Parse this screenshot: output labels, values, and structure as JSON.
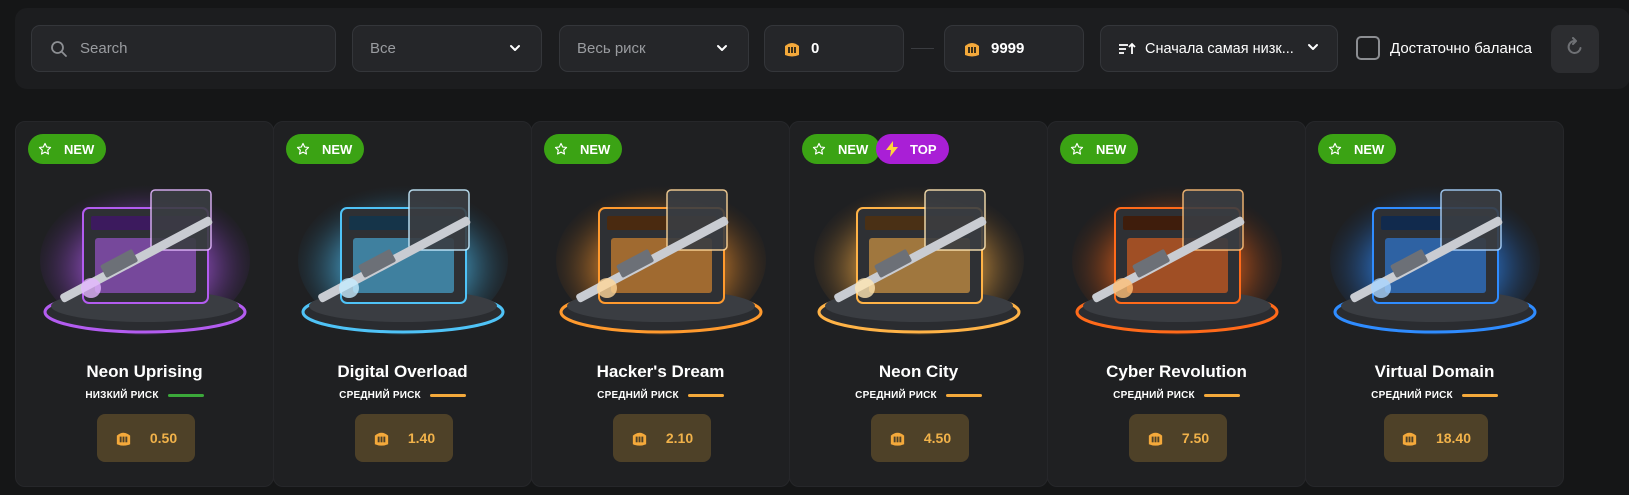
{
  "filters": {
    "search_placeholder": "Search",
    "category_value": "Все",
    "risk_value": "Весь риск",
    "price_min": "0",
    "price_max": "9999",
    "sort_value": "Сначала самая низк...",
    "balance_checkbox_label": "Достаточно баланса",
    "balance_checkbox_checked": false
  },
  "colors": {
    "accent_new": "#3ba314",
    "accent_top": "#a91fd6",
    "risk_low": "#3ba83a",
    "risk_medium": "#f4a93b",
    "price_text": "#f1b24a"
  },
  "cases": [
    {
      "name": "Neon Uprising",
      "badges": [
        "NEW"
      ],
      "risk": "НИЗКИЙ РИСК",
      "risk_level": "low",
      "price": "0.50",
      "theme": "purple"
    },
    {
      "name": "Digital Overload",
      "badges": [
        "NEW"
      ],
      "risk": "СРЕДНИЙ РИСК",
      "risk_level": "medium",
      "price": "1.40",
      "theme": "cyan"
    },
    {
      "name": "Hacker's Dream",
      "badges": [
        "NEW"
      ],
      "risk": "СРЕДНИЙ РИСК",
      "risk_level": "medium",
      "price": "2.10",
      "theme": "orange"
    },
    {
      "name": "Neon City",
      "badges": [
        "NEW",
        "TOP"
      ],
      "risk": "СРЕДНИЙ РИСК",
      "risk_level": "medium",
      "price": "4.50",
      "theme": "gold"
    },
    {
      "name": "Cyber Revolution",
      "badges": [
        "NEW"
      ],
      "risk": "СРЕДНИЙ РИСК",
      "risk_level": "medium",
      "price": "7.50",
      "theme": "fire"
    },
    {
      "name": "Virtual Domain",
      "badges": [
        "NEW"
      ],
      "risk": "СРЕДНИЙ РИСК",
      "risk_level": "medium",
      "price": "18.40",
      "theme": "blue"
    }
  ]
}
